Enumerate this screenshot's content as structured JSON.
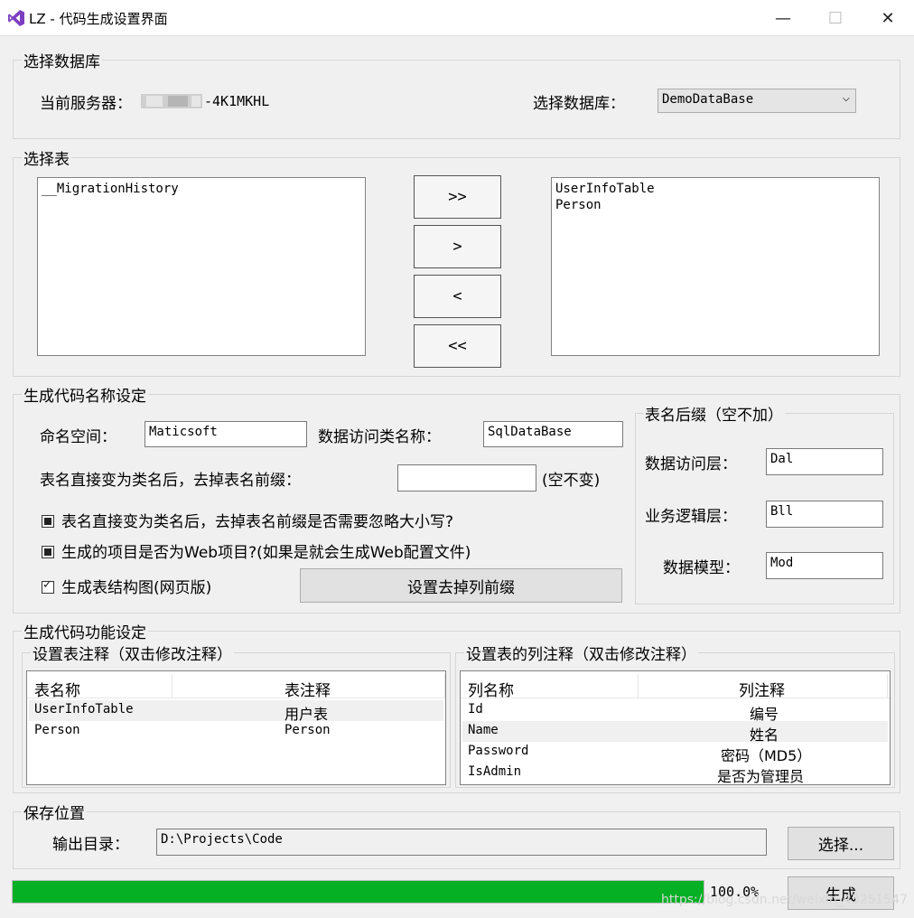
{
  "window": {
    "title": "LZ - 代码生成设置界面",
    "minimize": "—",
    "maximize": "☐",
    "close": "✕"
  },
  "db_group": {
    "title": "选择数据库",
    "server_label": "当前服务器：",
    "server_suffix": "-4K1MKHL",
    "db_label": "选择数据库：",
    "db_selected": "DemoDataBase"
  },
  "table_group": {
    "title": "选择表",
    "left_list": [
      "__MigrationHistory"
    ],
    "right_list": [
      "UserInfoTable",
      "Person"
    ],
    "buttons": {
      "move_all_right": ">>",
      "move_right": ">",
      "move_left": "<",
      "move_all_left": "<<"
    }
  },
  "naming_group": {
    "title": "生成代码名称设定",
    "namespace_label": "命名空间：",
    "namespace_value": "Maticsoft",
    "dal_class_label": "数据访问类名称：",
    "dal_class_value": "SqlDataBase",
    "prefix_label": "表名直接变为类名后，去掉表名前缀：",
    "prefix_value": "",
    "prefix_hint": "(空不变)",
    "check_ignore_case": "表名直接变为类名后，去掉表名前缀是否需要忽略大小写?",
    "check_web_project": "生成的项目是否为Web项目?(如果是就会生成Web配置文件)",
    "check_structure_map": "生成表结构图(网页版)",
    "column_prefix_button": "设置去掉列前缀"
  },
  "suffix_group": {
    "title": "表名后缀（空不加）",
    "dal_label": "数据访问层：",
    "dal_value": "Dal",
    "bll_label": "业务逻辑层：",
    "bll_value": "Bll",
    "model_label": "数据模型：",
    "model_value": "Mod"
  },
  "function_group": {
    "title": "生成代码功能设定",
    "table_comment_title": "设置表注释（双击修改注释）",
    "table_headers": [
      "表名称",
      "表注释"
    ],
    "table_rows": [
      [
        "UserInfoTable",
        "用户表"
      ],
      [
        "Person",
        "Person"
      ]
    ],
    "column_comment_title": "设置表的列注释（双击修改注释）",
    "column_headers": [
      "列名称",
      "列注释"
    ],
    "column_rows": [
      [
        "Id",
        "编号"
      ],
      [
        "Name",
        "姓名"
      ],
      [
        "Password",
        "密码（MD5）"
      ],
      [
        "IsAdmin",
        "是否为管理员"
      ]
    ]
  },
  "save_group": {
    "title": "保存位置",
    "output_label": "输出目录：",
    "output_value": "D:\\Projects\\Code",
    "browse_button": "选择..."
  },
  "footer": {
    "progress": 1.0,
    "progress_text": "100.0%",
    "generate_button": "生成",
    "watermark": "https://blog.csdn.net/weixin_43251547"
  },
  "colors": {
    "progress_fill": "#06b025",
    "window_bg": "#f0f0f0",
    "app_icon": "#7b3fbf"
  }
}
